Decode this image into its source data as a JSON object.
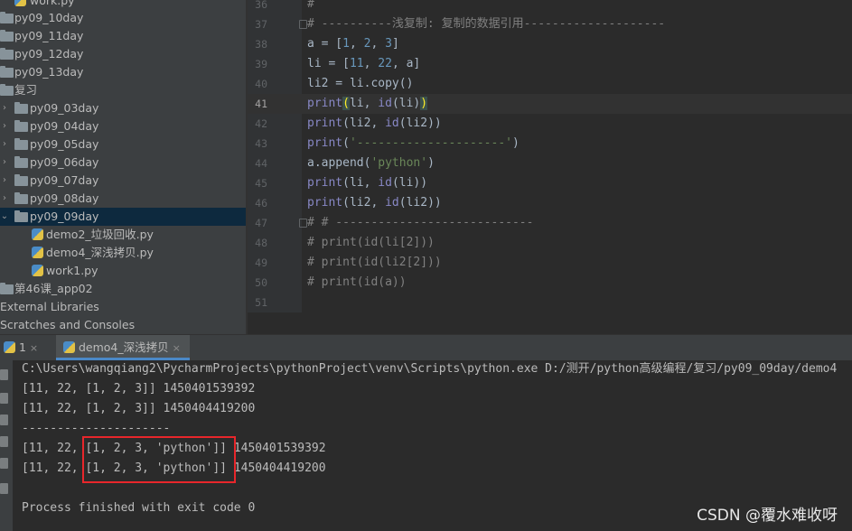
{
  "project_tree": {
    "items": [
      {
        "label": "work.py",
        "kind": "file",
        "level": 1
      },
      {
        "label": "py09_10day",
        "kind": "folder",
        "level": 0
      },
      {
        "label": "py09_11day",
        "kind": "folder",
        "level": 0
      },
      {
        "label": "py09_12day",
        "kind": "folder",
        "level": 0
      },
      {
        "label": "py09_13day",
        "kind": "folder",
        "level": 0
      },
      {
        "label": "复习",
        "kind": "folder",
        "level": 0
      },
      {
        "label": "py09_03day",
        "kind": "folder",
        "level": 1
      },
      {
        "label": "py09_04day",
        "kind": "folder",
        "level": 1
      },
      {
        "label": "py09_05day",
        "kind": "folder",
        "level": 1
      },
      {
        "label": "py09_06day",
        "kind": "folder",
        "level": 1
      },
      {
        "label": "py09_07day",
        "kind": "folder",
        "level": 1
      },
      {
        "label": "py09_08day",
        "kind": "folder",
        "level": 1
      },
      {
        "label": "py09_09day",
        "kind": "folder",
        "level": 1,
        "selected": true,
        "expanded": true
      },
      {
        "label": "demo2_垃圾回收.py",
        "kind": "file",
        "level": 2
      },
      {
        "label": "demo4_深浅拷贝.py",
        "kind": "file",
        "level": 2
      },
      {
        "label": "work1.py",
        "kind": "file",
        "level": 2
      },
      {
        "label": "第46课_app02",
        "kind": "folder",
        "level": 0
      },
      {
        "label": "External Libraries",
        "kind": "plain",
        "level": 0
      },
      {
        "label": "Scratches and Consoles",
        "kind": "plain",
        "level": 0
      }
    ]
  },
  "editor": {
    "current_line": 41,
    "line_numbers": [
      "36",
      "37",
      "38",
      "39",
      "40",
      "41",
      "42",
      "43",
      "44",
      "45",
      "46",
      "47",
      "48",
      "49",
      "50",
      "51"
    ],
    "lines": {
      "l36": "#",
      "l37": "# ----------浅复制: 复制的数据引用--------------------",
      "l38_a": "a = [",
      "l38_n1": "1",
      "l38_c1": ", ",
      "l38_n2": "2",
      "l38_c2": ", ",
      "l38_n3": "3",
      "l38_e": "]",
      "l39_a": "li = [",
      "l39_n1": "11",
      "l39_c1": ", ",
      "l39_n2": "22",
      "l39_e": ", a]",
      "l40": "li2 = li.copy()",
      "l41_kw": "print",
      "l41_p": "(",
      "l41_b": "li, ",
      "l41_id": "id",
      "l41_c": "(li)",
      "l41_pe": ")",
      "l42_kw": "print",
      "l42_b": "(li2, ",
      "l42_id": "id",
      "l42_c": "(li2))",
      "l43_kw": "print",
      "l43_p": "(",
      "l43_s": "'---------------------'",
      "l43_e": ")",
      "l44_a": "a.append(",
      "l44_s": "'python'",
      "l44_e": ")",
      "l45_kw": "print",
      "l45_b": "(li, ",
      "l45_id": "id",
      "l45_c": "(li))",
      "l46_kw": "print",
      "l46_b": "(li2, ",
      "l46_id": "id",
      "l46_c": "(li2))",
      "l47": "# # ----------------------------",
      "l48": "# print(id(li[2]))",
      "l49": "# print(id(li2[2]))",
      "l50": "# print(id(a))",
      "l51": ""
    }
  },
  "run_window": {
    "tab_run_label": "1",
    "tab_file_label": "demo4_深浅拷贝",
    "close_glyph": "×",
    "output": [
      "C:\\Users\\wangqiang2\\PycharmProjects\\pythonProject\\venv\\Scripts\\python.exe D:/测开/python高级编程/复习/py09_09day/demo4",
      "[11, 22, [1, 2, 3]] 1450401539392",
      "[11, 22, [1, 2, 3]] 1450404419200",
      "---------------------",
      "[11, 22, [1, 2, 3, 'python']] 1450401539392",
      "[11, 22, [1, 2, 3, 'python']] 1450404419200",
      "",
      "Process finished with exit code 0"
    ]
  },
  "watermark": "CSDN @覆水难收呀",
  "colors": {
    "accent": "#4a88c7",
    "highlight_box": "#e8262b",
    "selection": "#0d293e"
  }
}
